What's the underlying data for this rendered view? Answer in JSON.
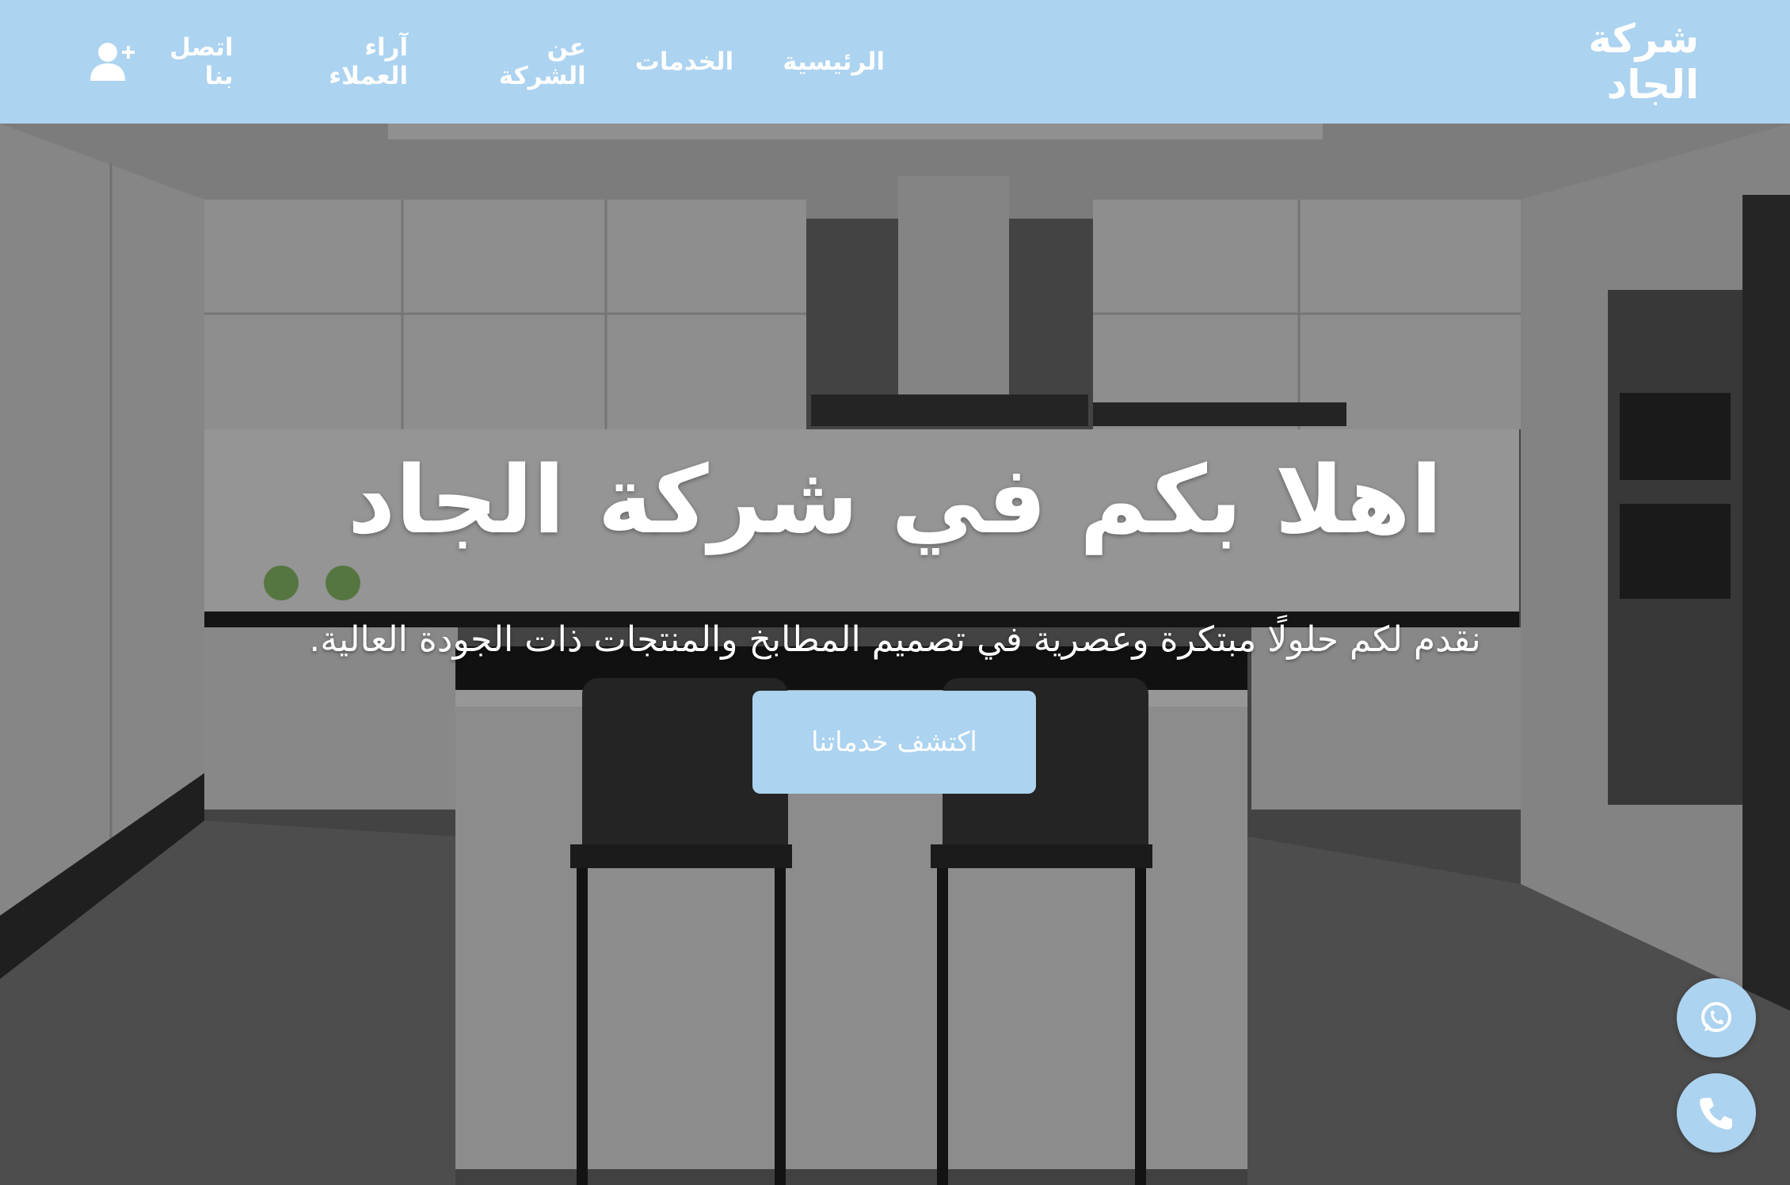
{
  "brand": {
    "name": "شركة الجاد"
  },
  "nav": {
    "items": [
      {
        "label": "الرئيسية",
        "id": "home"
      },
      {
        "label": "الخدمات",
        "id": "services"
      },
      {
        "label": "عن الشركة",
        "id": "about"
      },
      {
        "label": "آراء العملاء",
        "id": "testimonials"
      },
      {
        "label": "اتصل بنا",
        "id": "contact"
      }
    ],
    "user_icon": "user-plus-icon"
  },
  "hero": {
    "title": "اهلا بكم في شركة الجاد",
    "subtitle": "نقدم لكم حلولًا مبتكرة وعصرية في تصميم المطابخ والمنتجات ذات الجودة العالية.",
    "cta_label": "اكتشف خدماتنا",
    "background_icon": "kitchen-photo"
  },
  "floating": {
    "whatsapp_icon": "whatsapp-icon",
    "phone_icon": "phone-icon"
  },
  "colors": {
    "primary": "#acd3f0",
    "text_on_primary": "#ffffff"
  }
}
